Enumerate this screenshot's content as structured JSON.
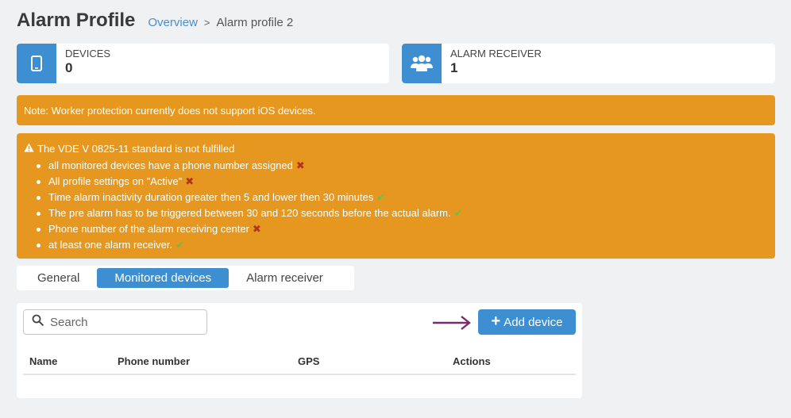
{
  "header": {
    "title": "Alarm Profile",
    "breadcrumb": {
      "link": "Overview",
      "separator": ">",
      "current": "Alarm profile 2"
    }
  },
  "cards": {
    "devices": {
      "label": "DEVICES",
      "value": "0",
      "icon": "phone-icon"
    },
    "receiver": {
      "label": "ALARM RECEIVER",
      "value": "1",
      "icon": "users-icon"
    }
  },
  "note": {
    "text": "Note: Worker protection currently does not support iOS devices."
  },
  "standard": {
    "title": "The VDE V 0825-11 standard is not fulfilled",
    "items": [
      {
        "text": "all monitored devices have a phone number assigned",
        "ok": false
      },
      {
        "text": "All profile settings on \"Active\"",
        "ok": false
      },
      {
        "text": "Time alarm inactivity duration greater then 5 and lower then 30 minutes",
        "ok": true
      },
      {
        "text": "The pre alarm has to be triggered between 30 and 120 seconds before the actual alarm.",
        "ok": true
      },
      {
        "text": "Phone number of the alarm receiving center",
        "ok": false
      },
      {
        "text": "at least one alarm receiver.",
        "ok": true
      }
    ]
  },
  "tabs": {
    "general": "General",
    "monitored": "Monitored devices",
    "receiver": "Alarm receiver",
    "active": "Monitored devices"
  },
  "panel": {
    "search_placeholder": "Search",
    "add_button": "Add device",
    "columns": {
      "name": "Name",
      "phone": "Phone number",
      "gps": "GPS",
      "actions": "Actions"
    }
  },
  "colors": {
    "primary": "#3d8fd1",
    "warning": "#e69720",
    "fail": "#b3341d",
    "pass": "#5fc44a",
    "arrow": "#7b2a6e"
  }
}
